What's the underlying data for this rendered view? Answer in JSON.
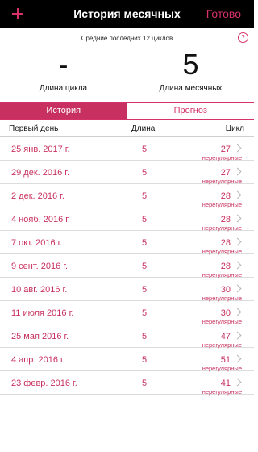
{
  "navbar": {
    "title": "История месячных",
    "done_label": "Готово"
  },
  "summary": {
    "caption": "Средние последних 12 циклов",
    "help_symbol": "?",
    "cycle_length": {
      "value": "-",
      "label": "Длина цикла"
    },
    "period_length": {
      "value": "5",
      "label": "Длина месячных"
    }
  },
  "tabs": [
    {
      "label": "История",
      "active": true
    },
    {
      "label": "Прогноз",
      "active": false
    }
  ],
  "table": {
    "headers": {
      "first_day": "Первый день",
      "length": "Длина",
      "cycle": "Цикл"
    },
    "rows": [
      {
        "date": "25 янв. 2017 г.",
        "length": "5",
        "cycle": "27",
        "note": "нерегулярные"
      },
      {
        "date": "29 дек. 2016 г.",
        "length": "5",
        "cycle": "27",
        "note": "нерегулярные"
      },
      {
        "date": "2 дек. 2016 г.",
        "length": "5",
        "cycle": "28",
        "note": "нерегулярные"
      },
      {
        "date": "4 нояб. 2016 г.",
        "length": "5",
        "cycle": "28",
        "note": "нерегулярные"
      },
      {
        "date": "7 окт. 2016 г.",
        "length": "5",
        "cycle": "28",
        "note": "нерегулярные"
      },
      {
        "date": "9 сент. 2016 г.",
        "length": "5",
        "cycle": "28",
        "note": "нерегулярные"
      },
      {
        "date": "10 авг. 2016 г.",
        "length": "5",
        "cycle": "30",
        "note": "нерегулярные"
      },
      {
        "date": "11 июля 2016 г.",
        "length": "5",
        "cycle": "30",
        "note": "нерегулярные"
      },
      {
        "date": "25 мая 2016 г.",
        "length": "5",
        "cycle": "47",
        "note": "нерегулярные"
      },
      {
        "date": "4 апр. 2016 г.",
        "length": "5",
        "cycle": "51",
        "note": "нерегулярные"
      },
      {
        "date": "23 февр. 2016 г.",
        "length": "5",
        "cycle": "41",
        "note": "нерегулярные"
      }
    ]
  },
  "colors": {
    "accent": "#c8315f",
    "navbar": "#000000"
  }
}
